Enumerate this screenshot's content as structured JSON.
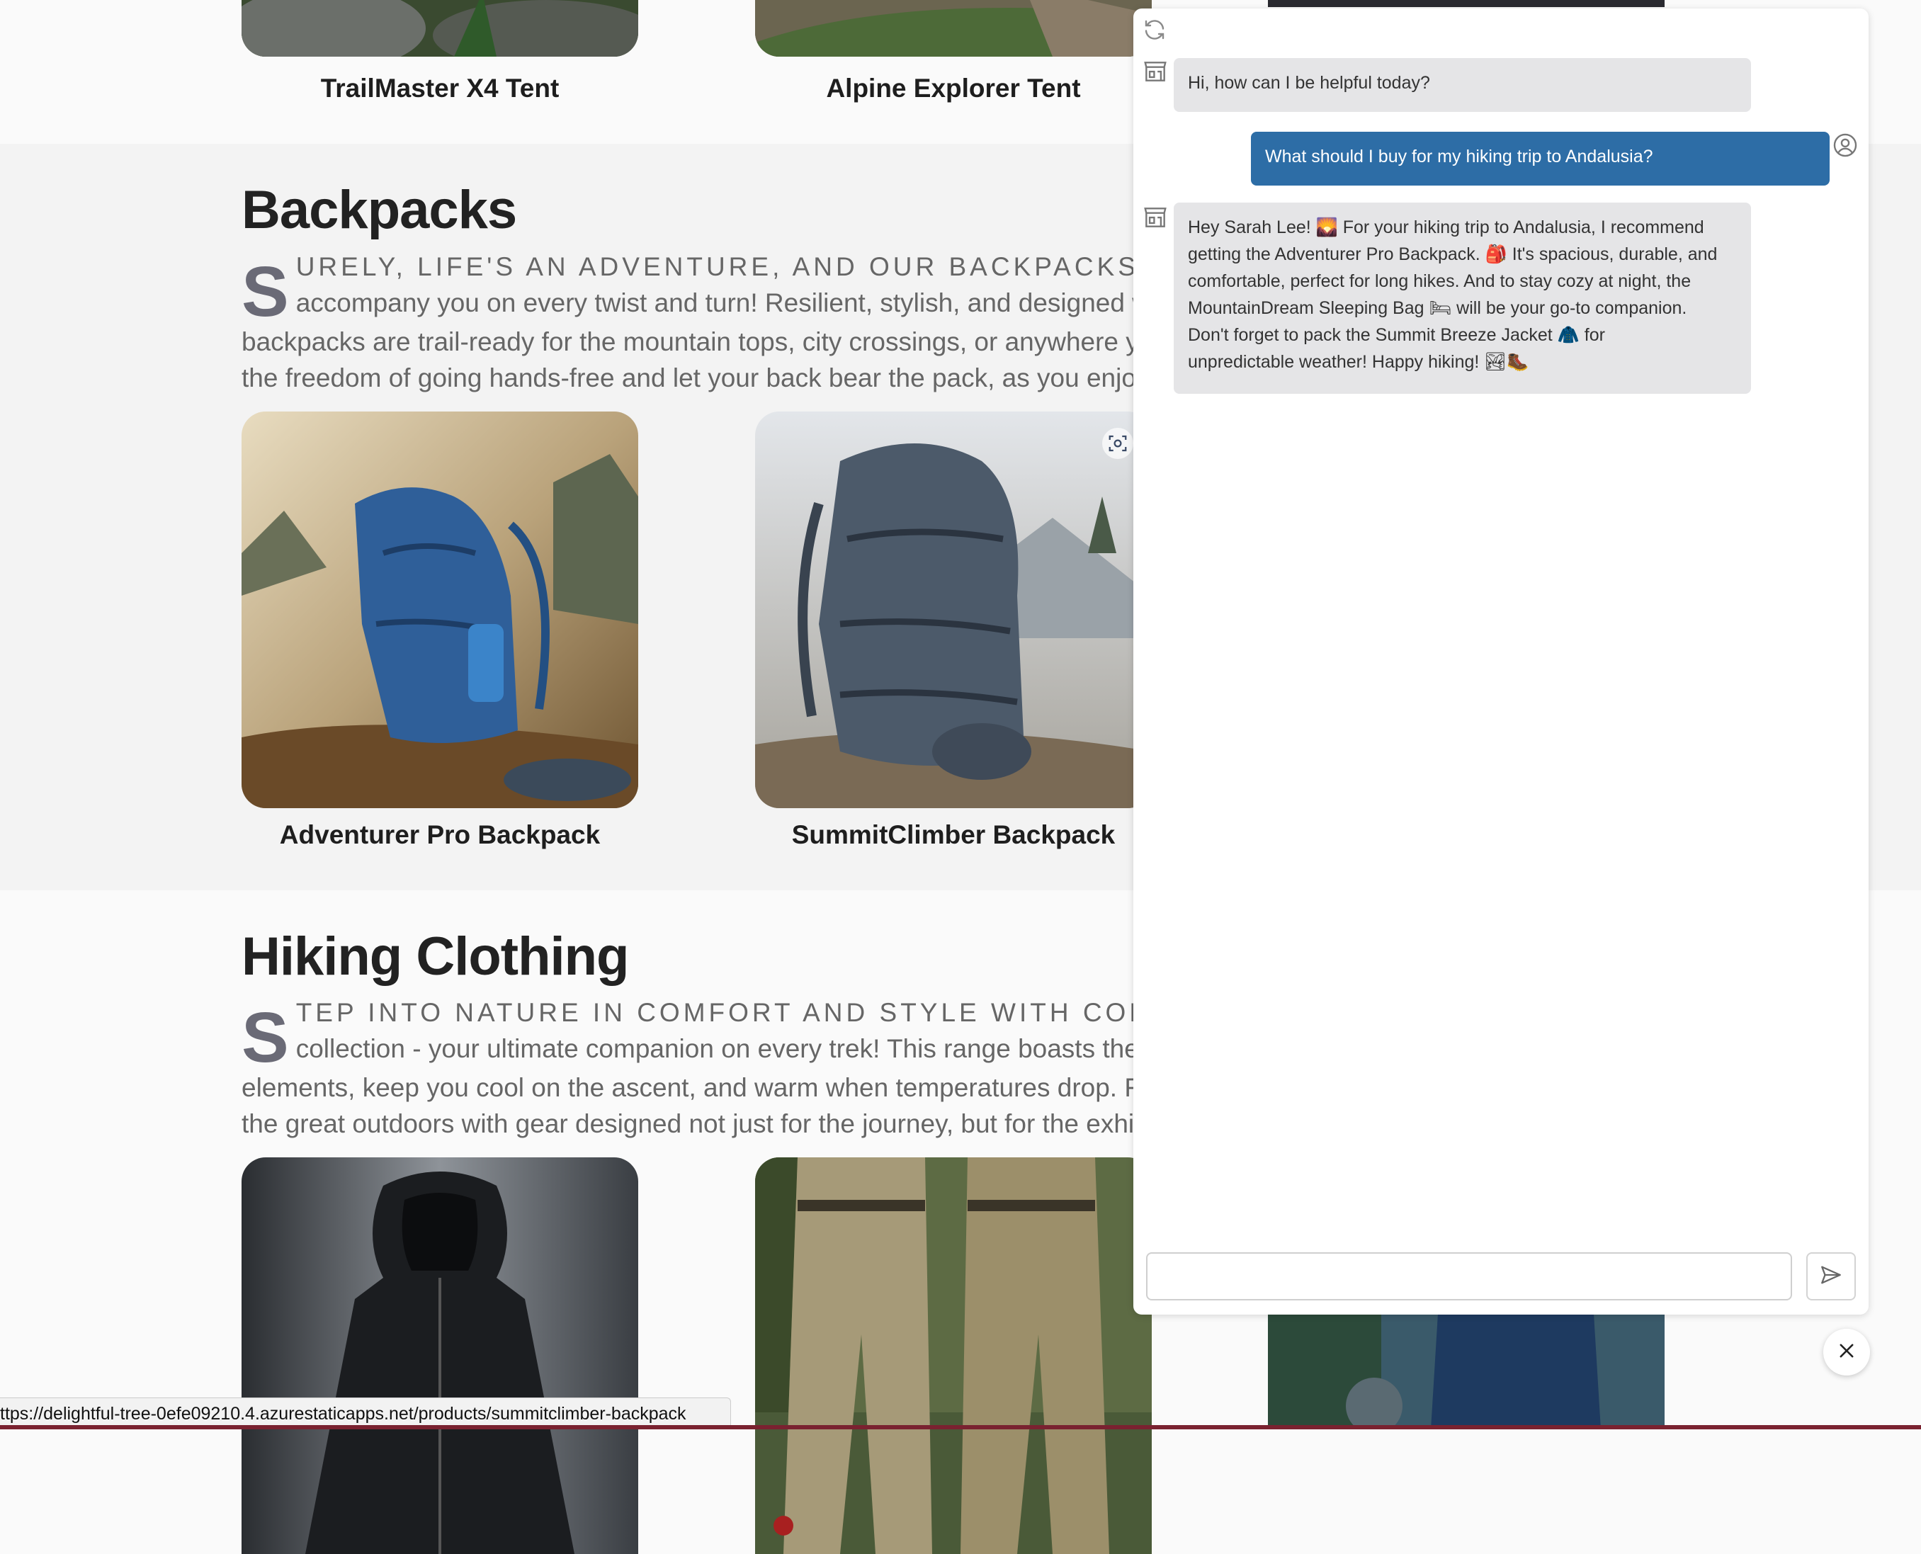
{
  "tents": {
    "items": [
      {
        "name": "TrailMaster X4 Tent"
      },
      {
        "name": "Alpine Explorer Tent"
      }
    ]
  },
  "backpacks": {
    "heading": "Backpacks",
    "drop_cap": "S",
    "lead_caps": "urely, life's an adventure, and our backpacks cat",
    "line2": "accompany you on every twist and turn! Resilient, stylish, and designed w",
    "line3": "backpacks are trail-ready for the mountain tops, city crossings, or anywhere y",
    "line4": "the freedom of going hands-free and let your back bear the pack, as you enjo",
    "items": [
      {
        "name": "Adventurer Pro Backpack"
      },
      {
        "name": "SummitClimber Backpack"
      }
    ]
  },
  "clothing": {
    "heading": "Hiking Clothing",
    "drop_cap": "S",
    "lead_caps": "tep into nature in comfort and style with contos",
    "line2": "collection - your ultimate companion on every trek! This range boasts the",
    "line3": "elements, keep you cool on the ascent, and warm when temperatures drop. Fr",
    "line4": "the great outdoors with gear designed not just for the journey, but for the exhi"
  },
  "chat": {
    "messages": [
      {
        "role": "bot",
        "text": "Hi, how can I be helpful today?"
      },
      {
        "role": "user",
        "text": "What should I buy for my hiking trip to Andalusia?"
      },
      {
        "role": "bot",
        "lines": [
          "Hey Sarah Lee! 🌄 For your hiking trip to Andalusia, I recommend",
          "getting the Adventurer Pro Backpack. 🎒 It's spacious, durable, and",
          "comfortable, perfect for long hikes. And to stay cozy at night, the",
          "MountainDream Sleeping Bag 🛏 will be your go-to companion.",
          "Don't forget to pack the Summit Breeze Jacket 🧥 for",
          "unpredictable weather! Happy hiking! 🏞🥾"
        ]
      }
    ],
    "input_value": ""
  },
  "status_url": "ttps://delightful-tree-0efe09210.4.azurestaticapps.net/products/summitclimber-backpack",
  "icons": {
    "refresh": "refresh-icon",
    "bot": "store-icon",
    "user": "user-circle-icon",
    "send": "send-icon",
    "close": "close-icon",
    "scan": "visual-search-icon"
  },
  "colors": {
    "user_bubble": "#2d6da6",
    "bot_bubble": "#e5e5e7",
    "accent_bottom": "#7a2230"
  }
}
